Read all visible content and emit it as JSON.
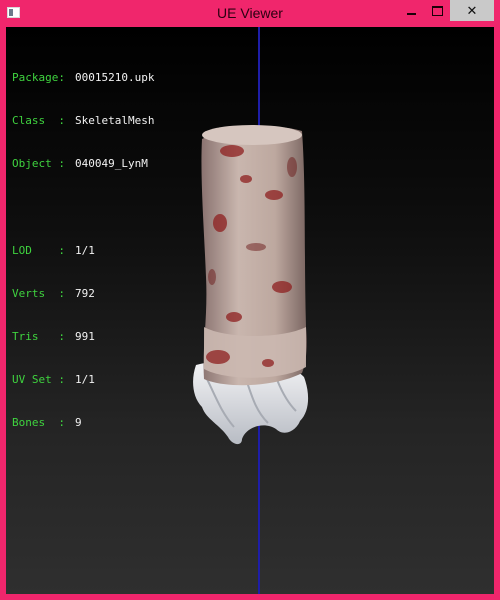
{
  "window": {
    "title": "UE Viewer",
    "icons": [
      "app-icon",
      "minimize-icon",
      "maximize-icon",
      "close-icon"
    ],
    "close_glyph": "✕",
    "colors": {
      "frame": "#f0266c",
      "close_hover": "#c9c9c9",
      "label_green": "#3fd33f",
      "axis_blue": "#1e1ea8"
    }
  },
  "info": {
    "package_label": "Package:",
    "package_value": "00015210.upk",
    "class_label": "Class  :",
    "class_value": "SkeletalMesh",
    "object_label": "Object :",
    "object_value": "040049_LynM",
    "lod_label": "LOD    :",
    "lod_value": "1/1",
    "verts_label": "Verts  :",
    "verts_value": "792",
    "tris_label": "Tris   :",
    "tris_value": "991",
    "uvset_label": "UV Set :",
    "uvset_value": "1/1",
    "bones_label": "Bones  :",
    "bones_value": "9"
  }
}
